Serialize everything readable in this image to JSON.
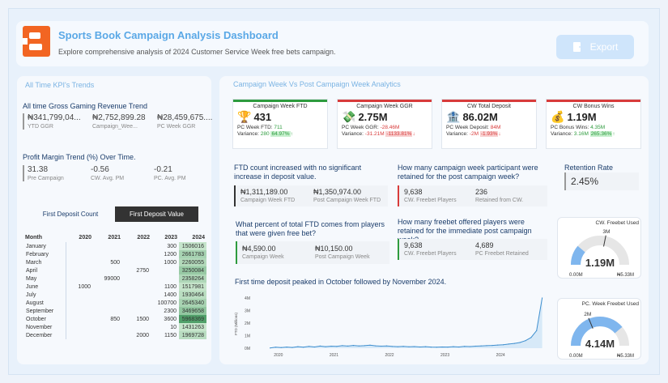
{
  "header": {
    "title": "Sports Book Campaign Analysis Dashboard",
    "subtitle": "Explore comprehensive analysis of 2024 Customer Service Week free bets campaign.",
    "export_label": "Export",
    "brand_color": "#f26522"
  },
  "left": {
    "section_title": "All Time KPI's Trends",
    "ggr_title": "All time Gross Gaming Revenue Trend",
    "ggr_kpis": [
      {
        "value": "₦341,799,04...",
        "label": "YTD GGR"
      },
      {
        "value": "₦2,752,899.28",
        "label": "Campaign_Wee..."
      },
      {
        "value": "₦28,459,675....",
        "label": "PC Week GGR"
      }
    ],
    "pm_title": "Profit Margin Trend (%) Over Time.",
    "pm_kpis": [
      {
        "value": "31.38",
        "label": "Pre Campaign"
      },
      {
        "value": "-0.56",
        "label": "CW. Avg. PM"
      },
      {
        "value": "-0.21",
        "label": "PC. Avg. PM"
      }
    ],
    "tab_count": "First Deposit Count",
    "tab_value": "First Deposit Value",
    "table": {
      "headers": [
        "Month",
        "2020",
        "2021",
        "2022",
        "2023",
        "2024"
      ],
      "rows": [
        [
          "January",
          "",
          "",
          "",
          "300",
          "1506016"
        ],
        [
          "February",
          "",
          "",
          "",
          "1200",
          "2661783"
        ],
        [
          "March",
          "",
          "500",
          "",
          "1000",
          "2260055"
        ],
        [
          "April",
          "",
          "",
          "2750",
          "",
          "3250084"
        ],
        [
          "May",
          "",
          "99000",
          "",
          "",
          "2358264"
        ],
        [
          "June",
          "1000",
          "",
          "",
          "1100",
          "1517981"
        ],
        [
          "July",
          "",
          "",
          "",
          "1400",
          "1930464"
        ],
        [
          "August",
          "",
          "",
          "",
          "100700",
          "2645340"
        ],
        [
          "September",
          "",
          "",
          "",
          "2300",
          "3469658"
        ],
        [
          "October",
          "",
          "850",
          "1500",
          "3600",
          "5968369"
        ],
        [
          "November",
          "",
          "",
          "",
          "10",
          "1431263"
        ],
        [
          "December",
          "",
          "",
          "2000",
          "1150",
          "1969728"
        ]
      ]
    }
  },
  "right": {
    "section_title": "Campaign Week Vs Post Campaign Week Analytics",
    "cards": [
      {
        "title": "Campaign Week FTD",
        "value": "431",
        "line1_label": "PC Week FTD: ",
        "line1_value": "711",
        "var_label": "Variance: ",
        "var_value": "280",
        "var_pct": "64.97%",
        "positive": true,
        "accent": "#2e9b3e",
        "icon": "trophy-icon"
      },
      {
        "title": "Campaign Week GGR",
        "value": "2.75M",
        "line1_label": "PC Week GGR: ",
        "line1_value": "-28.46M",
        "var_label": "Variance: ",
        "var_value": "-31.21M",
        "var_pct": "-1133.81%",
        "positive": false,
        "accent": "#d83b3b",
        "icon": "money-icon"
      },
      {
        "title": "CW Total Deposit",
        "value": "86.02M",
        "line1_label": "PC Week Deposit: ",
        "line1_value": "84M",
        "var_label": "Variance: ",
        "var_value": "-2M",
        "var_pct": "-1.93%",
        "positive": false,
        "accent": "#d83b3b",
        "icon": "bank-icon"
      },
      {
        "title": "CW Bonus Wins",
        "value": "1.19M",
        "line1_label": "PC Bonus Wins: ",
        "line1_value": "4.35M",
        "var_label": "Variance: ",
        "var_value": "3.16M",
        "var_pct": "265.36%",
        "positive": true,
        "accent": "#d83b3b",
        "icon": "money-bag-icon"
      }
    ],
    "q1": {
      "title": "FTD count increased with no significant increase in deposit value.",
      "items": [
        {
          "value": "₦1,311,189.00",
          "label": "Campaign Week FTD"
        },
        {
          "value": "₦1,350,974.00",
          "label": "Post Campaign Week FTD"
        }
      ]
    },
    "q2": {
      "title": "How many campaign week participant were retained for the post campaign week?",
      "items": [
        {
          "value": "9,638",
          "label": "CW. Freebet Players"
        },
        {
          "value": "236",
          "label": "Retained from CW."
        }
      ]
    },
    "retention": {
      "title": "Retention Rate",
      "value": "2.45%"
    },
    "q3": {
      "title": "What percent of total FTD comes from players that were given free bet?",
      "items": [
        {
          "value": "₦4,590.00",
          "label": "Campaign Week"
        },
        {
          "value": "₦10,150.00",
          "label": "Post Campaign Week"
        }
      ]
    },
    "q4": {
      "title": "How many freebet offered players were retained for the immediate post campaign week?",
      "items": [
        {
          "value": "9,638",
          "label": "CW. Freebet Players"
        },
        {
          "value": "4,689",
          "label": "PC Freebet Retained"
        }
      ]
    },
    "gauge1": {
      "title": "CW. Freebet Used",
      "value": "1.19M",
      "target": "3M",
      "min": "0.00M",
      "max": "₦5.33M",
      "fraction": 0.223
    },
    "gauge2": {
      "title": "PC. Week Freebet Used",
      "value": "4.14M",
      "target": "2M",
      "min": "0.00M",
      "max": "₦5.33M",
      "fraction": 0.777
    },
    "chart_title": "First time deposit peaked in October followed by November 2024."
  },
  "chart_data": {
    "type": "area",
    "title": "First time deposit peaked in October followed by November 2024.",
    "ylabel": "FTD (Millions)",
    "x_ticks": [
      "2020",
      "2021",
      "2022",
      "2023",
      "2024"
    ],
    "y_ticks": [
      "0M",
      "1M",
      "2M",
      "3M",
      "4M"
    ],
    "ylim": [
      0,
      4
    ],
    "x": [
      2020.0,
      2020.1,
      2020.2,
      2020.3,
      2020.4,
      2020.5,
      2020.6,
      2020.7,
      2020.8,
      2020.9,
      2021.0,
      2021.1,
      2021.2,
      2021.3,
      2021.4,
      2021.5,
      2021.6,
      2021.7,
      2021.8,
      2021.9,
      2022.0,
      2022.1,
      2022.2,
      2022.3,
      2022.4,
      2022.5,
      2022.6,
      2022.7,
      2022.8,
      2022.9,
      2023.0,
      2023.1,
      2023.2,
      2023.3,
      2023.4,
      2023.5,
      2023.6,
      2023.7,
      2023.8,
      2023.9,
      2024.0,
      2024.1,
      2024.2,
      2024.3,
      2024.4,
      2024.5,
      2024.6,
      2024.7,
      2024.8,
      2024.9
    ],
    "values": [
      0.02,
      0.08,
      0.05,
      0.09,
      0.06,
      0.12,
      0.08,
      0.14,
      0.1,
      0.17,
      0.12,
      0.16,
      0.14,
      0.2,
      0.17,
      0.22,
      0.18,
      0.2,
      0.24,
      0.19,
      0.16,
      0.18,
      0.14,
      0.12,
      0.15,
      0.11,
      0.13,
      0.1,
      0.12,
      0.09,
      0.08,
      0.1,
      0.09,
      0.12,
      0.1,
      0.15,
      0.13,
      0.16,
      0.18,
      0.2,
      0.22,
      0.25,
      0.28,
      0.33,
      0.38,
      0.45,
      0.6,
      0.85,
      1.4,
      4.0
    ]
  }
}
